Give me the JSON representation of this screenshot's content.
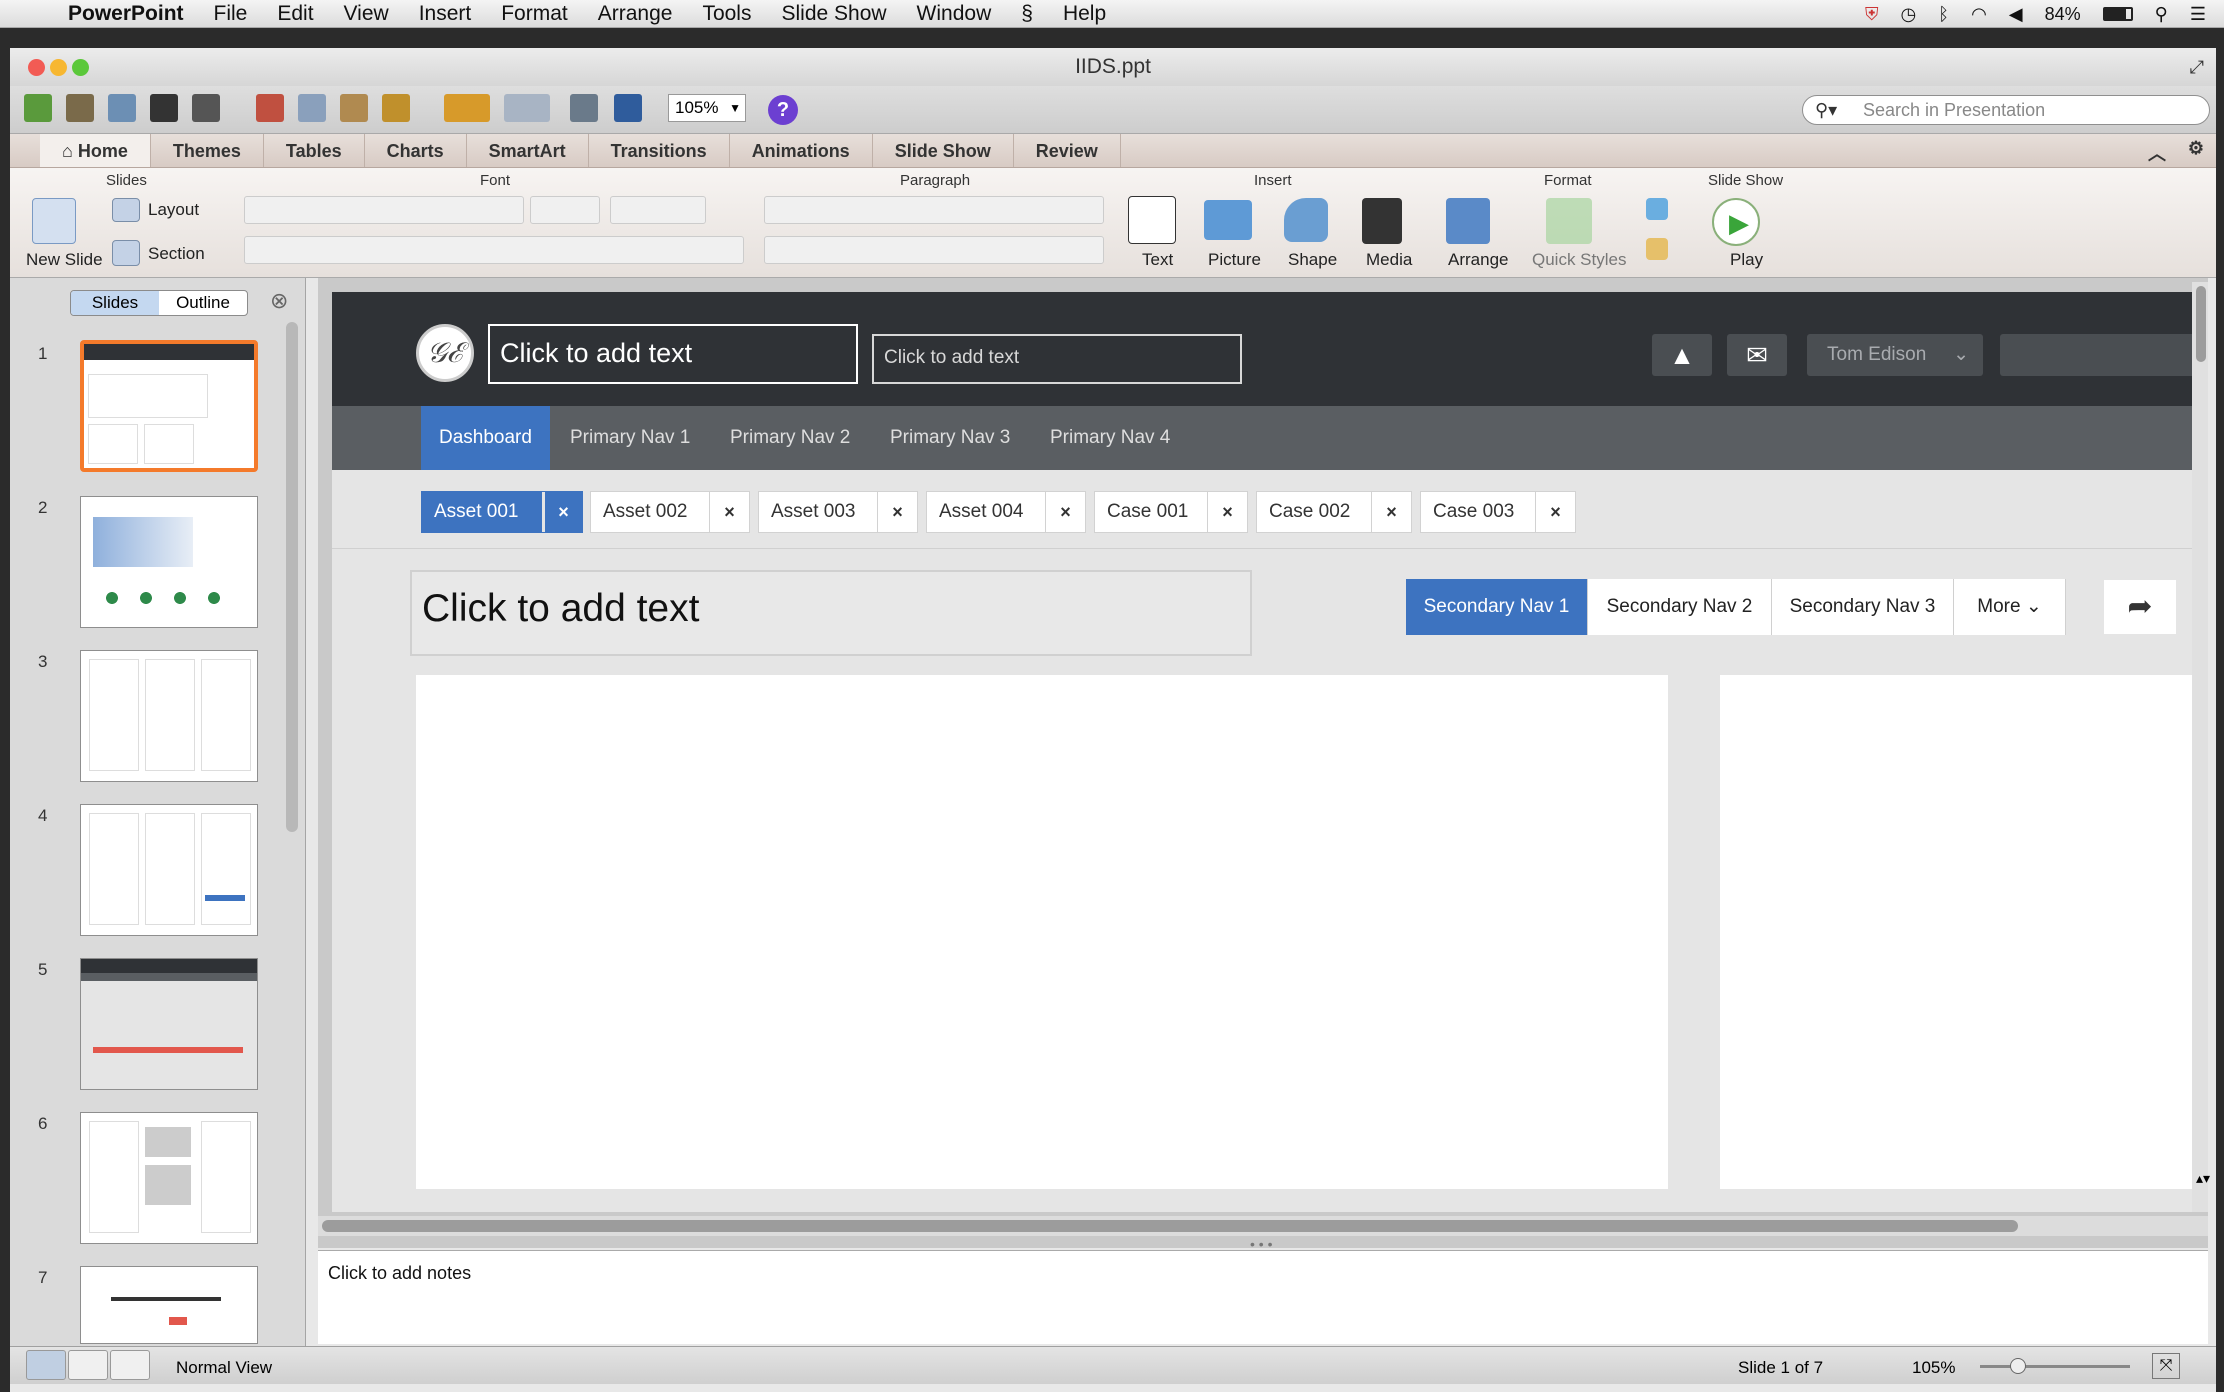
{
  "menubar": {
    "apple": "",
    "app": "PowerPoint",
    "items": [
      "File",
      "Edit",
      "View",
      "Insert",
      "Format",
      "Arrange",
      "Tools",
      "Slide Show",
      "Window",
      "Help"
    ],
    "battery": "84%"
  },
  "window": {
    "title": "IIDS.ppt"
  },
  "toolbar": {
    "zoom": "105%",
    "help": "?",
    "search_placeholder": "Search in Presentation"
  },
  "ribbon": {
    "tabs": [
      "Home",
      "Themes",
      "Tables",
      "Charts",
      "SmartArt",
      "Transitions",
      "Animations",
      "Slide Show",
      "Review"
    ],
    "groups": {
      "slides": "Slides",
      "font": "Font",
      "paragraph": "Paragraph",
      "insert": "Insert",
      "format": "Format",
      "slideshow": "Slide Show"
    },
    "slides": {
      "new_slide": "New Slide",
      "layout": "Layout",
      "section": "Section"
    },
    "insert": {
      "text": "Text",
      "picture": "Picture",
      "shape": "Shape",
      "media": "Media"
    },
    "format": {
      "arrange": "Arrange",
      "quick_styles": "Quick Styles"
    },
    "slideshow": {
      "play": "Play"
    }
  },
  "sidebar": {
    "segments": [
      "Slides",
      "Outline"
    ],
    "slide_numbers": [
      "1",
      "2",
      "3",
      "4",
      "5",
      "6",
      "7"
    ]
  },
  "slide": {
    "header": {
      "title_placeholder": "Click to add text",
      "subtitle_placeholder": "Click to add text",
      "user": "Tom  Edison"
    },
    "primary_nav": [
      "Dashboard",
      "Primary Nav 1",
      "Primary Nav 2",
      "Primary Nav 3",
      "Primary Nav 4"
    ],
    "chips": [
      "Asset 001",
      "Asset 002",
      "Asset 003",
      "Asset 004",
      "Case 001",
      "Case 002",
      "Case 003"
    ],
    "chip_close": "×",
    "page_title": "Click to add text",
    "secondary_nav": [
      "Secondary Nav 1",
      "Secondary Nav 2",
      "Secondary Nav 3",
      "More"
    ]
  },
  "notes": {
    "placeholder": "Click to add notes"
  },
  "status": {
    "view": "Normal View",
    "slide_counter": "Slide 1 of 7",
    "zoom": "105%"
  },
  "colors": {
    "accent": "#3d73c0",
    "topbar": "#2f3236",
    "navbar": "#5a5e62",
    "selection": "#f47a2b"
  }
}
